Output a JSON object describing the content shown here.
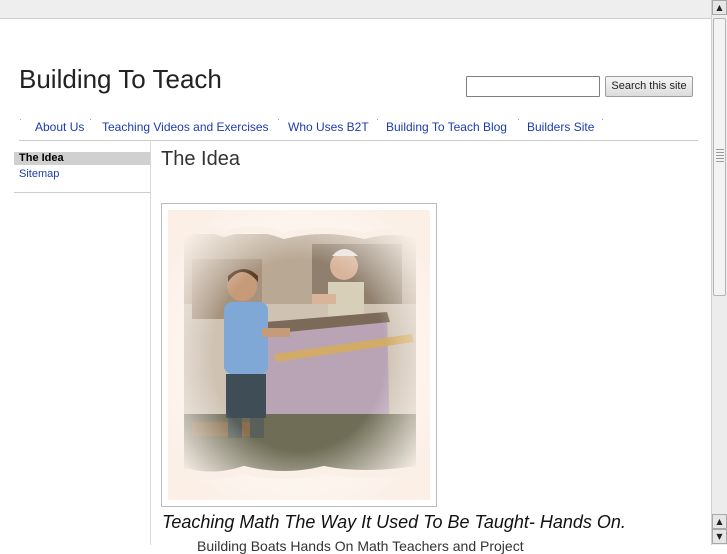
{
  "site": {
    "title": "Building To Teach"
  },
  "search": {
    "placeholder": "",
    "value": "",
    "button_label": "Search this site"
  },
  "nav": {
    "items": [
      {
        "label": "About Us"
      },
      {
        "label": "Teaching Videos and Exercises"
      },
      {
        "label": "Who Uses B2T"
      },
      {
        "label": "Building To Teach Blog"
      },
      {
        "label": "Builders Site"
      }
    ]
  },
  "sidebar": {
    "items": [
      {
        "label": "The Idea",
        "active": true
      },
      {
        "label": "Sitemap",
        "active": false
      }
    ]
  },
  "main": {
    "page_title": "The Idea",
    "image": {
      "description_icon": "photo-child-and-man-building-boat"
    },
    "tagline": "Teaching Math The Way It Used To Be Taught- Hands On.",
    "body_partial": "Building Boats Hands On Math Teachers and Project"
  },
  "colors": {
    "link": "#1a3cb0",
    "active_bg": "#d0d0d0",
    "divider": "#cccccc"
  }
}
